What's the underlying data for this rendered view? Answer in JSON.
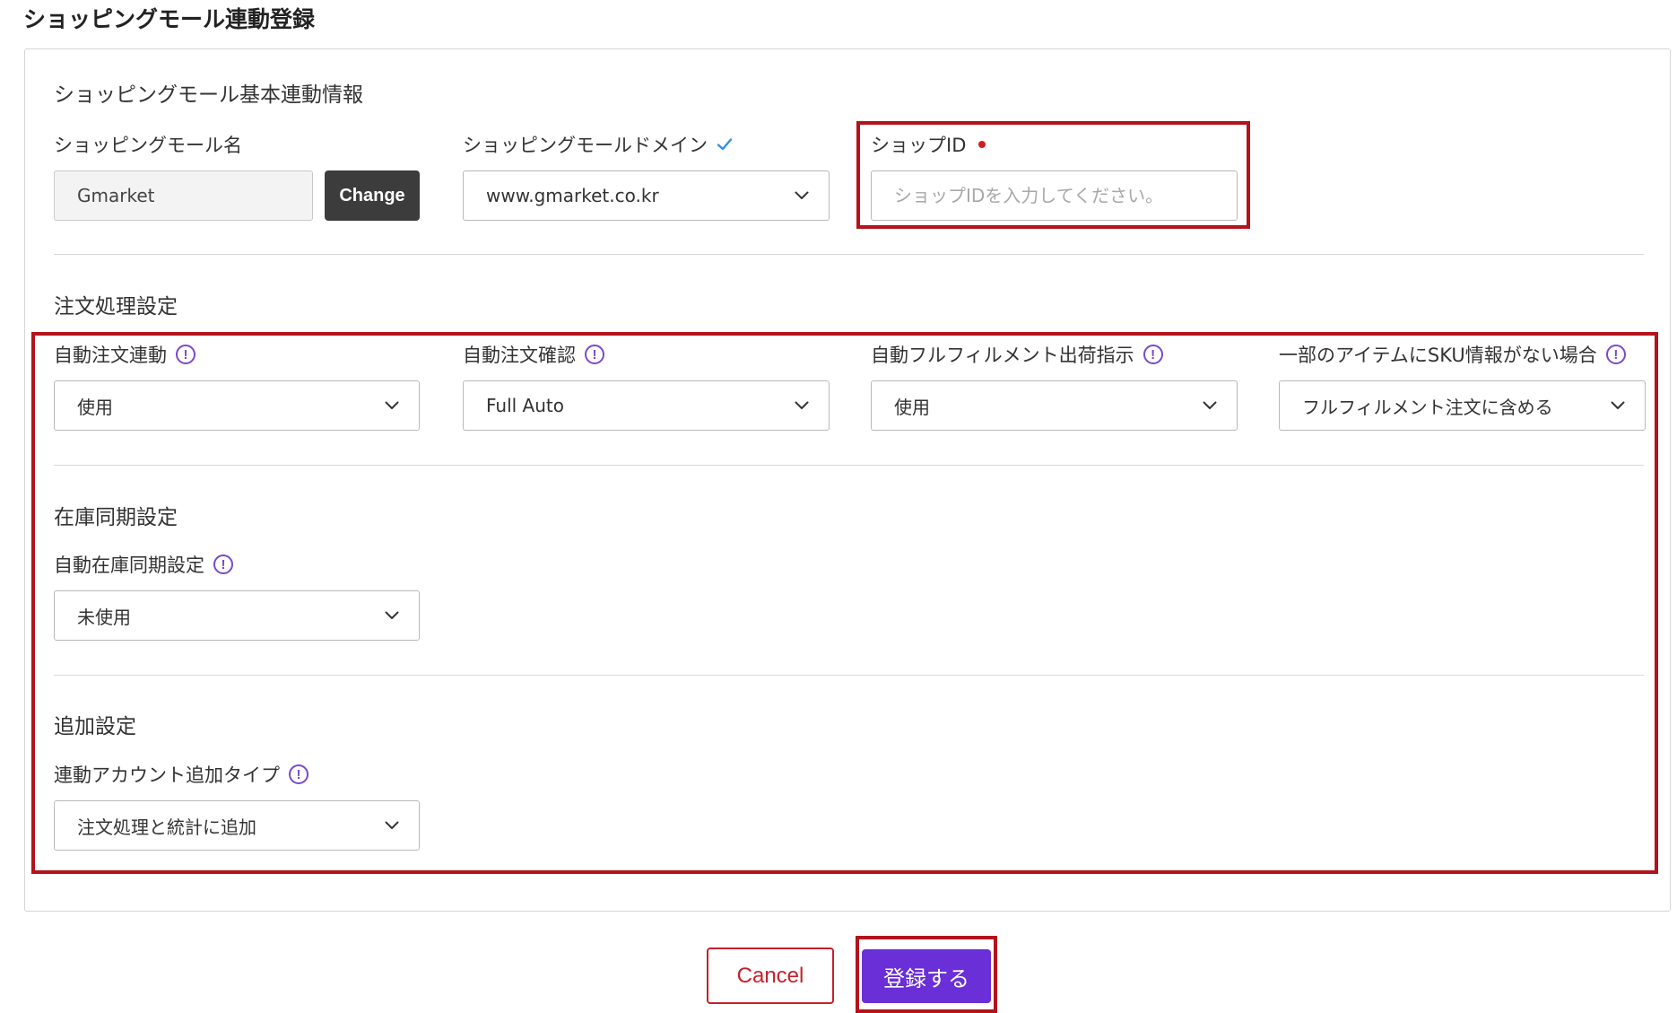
{
  "page": {
    "title": "ショッピングモール連動登録"
  },
  "sections": {
    "basic": {
      "title": "ショッピングモール基本連動情報",
      "mall_name": {
        "label": "ショッピングモール名",
        "value": "Gmarket",
        "change_label": "Change"
      },
      "mall_domain": {
        "label": "ショッピングモールドメイン",
        "value": "www.gmarket.co.kr",
        "verified_icon": "check-icon"
      },
      "shop_id": {
        "label": "ショップID",
        "placeholder": "ショップIDを入力してください。",
        "value": "",
        "required": true
      }
    },
    "order": {
      "title": "注文処理設定",
      "auto_order_link": {
        "label": "自動注文連動",
        "value": "使用"
      },
      "auto_order_confirm": {
        "label": "自動注文確認",
        "value": "Full Auto"
      },
      "auto_fulfillment": {
        "label": "自動フルフィルメント出荷指示",
        "value": "使用"
      },
      "no_sku": {
        "label": "一部のアイテムにSKU情報がない場合",
        "value": "フルフィルメント注文に含める"
      }
    },
    "inventory": {
      "title": "在庫同期設定",
      "auto_sync": {
        "label": "自動在庫同期設定",
        "value": "未使用"
      }
    },
    "additional": {
      "title": "追加設定",
      "account_type": {
        "label": "連動アカウント追加タイプ",
        "value": "注文処理と統計に追加"
      }
    }
  },
  "actions": {
    "cancel_label": "Cancel",
    "submit_label": "登録する"
  },
  "colors": {
    "accent": "#6a2fd6",
    "info_icon": "#7b48cc",
    "highlight": "#b3131b",
    "cancel": "#c8202a",
    "change_button": "#3c3c3c",
    "verified_check": "#2f8fe6",
    "required_dot": "#cc1f1f"
  }
}
